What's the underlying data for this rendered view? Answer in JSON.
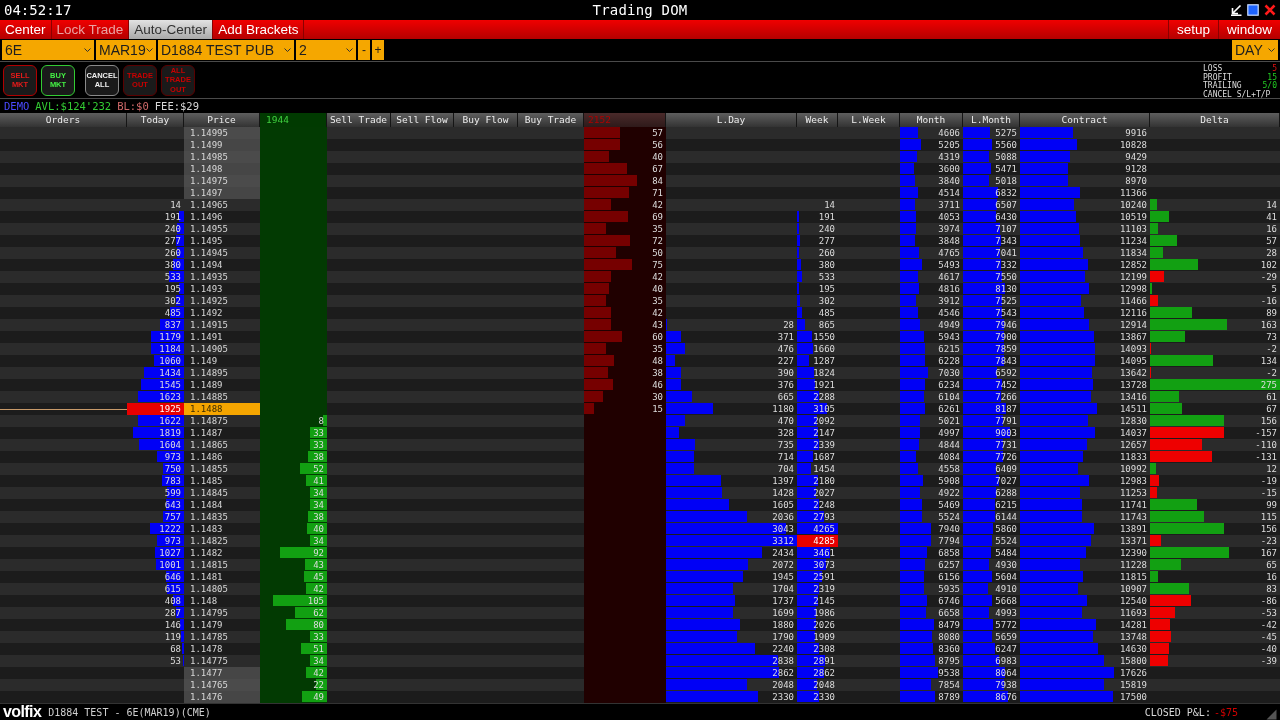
{
  "title_bar": {
    "time": "04:52:17",
    "title": "Trading DOM"
  },
  "toolbar": {
    "items": [
      {
        "label": "Center",
        "on": false,
        "disabled": false
      },
      {
        "label": "Lock Trade",
        "on": false,
        "disabled": true
      },
      {
        "label": "Auto-Center",
        "on": true,
        "disabled": false
      },
      {
        "label": "Add Brackets",
        "on": false,
        "disabled": false
      }
    ],
    "right_items": [
      "setup",
      "window"
    ]
  },
  "selectors": [
    {
      "value": "6E",
      "kind": "dropdown"
    },
    {
      "value": "MAR19",
      "kind": "dropdown"
    },
    {
      "value": "D1884 TEST PUB",
      "kind": "dropdown"
    },
    {
      "value": "2",
      "kind": "dropdown"
    },
    {
      "value": "-",
      "kind": "stepper"
    },
    {
      "value": "+",
      "kind": "stepper"
    }
  ],
  "session": {
    "value": "DAY"
  },
  "order_buttons": [
    {
      "label": "SELL MKT",
      "kind": "sell"
    },
    {
      "label": "BUY MKT",
      "kind": "buy"
    },
    {
      "label": "CANCEL ALL",
      "kind": "cancel"
    },
    {
      "label": "TRADE OUT",
      "kind": "exit"
    },
    {
      "label": "ALL TRADE OUT",
      "kind": "exit"
    }
  ],
  "risk_settings": [
    {
      "label": "LOSS",
      "value": "5",
      "kind": "loss"
    },
    {
      "label": "PROFIT",
      "value": "15",
      "kind": "gain"
    },
    {
      "label": "TRAILING",
      "value": "5/0",
      "kind": "gain"
    },
    {
      "label": "CANCEL S/L+T/P",
      "kind": "action"
    }
  ],
  "account": [
    {
      "text": "DEMO",
      "kind": "mode"
    },
    {
      "text": "AVL:$124'232",
      "kind": "available"
    },
    {
      "text": "BL:$0",
      "kind": "balance"
    },
    {
      "text": "FEE:$29",
      "kind": "fee"
    }
  ],
  "dom": {
    "columns": [
      {
        "label": "Orders",
        "kind": "orders"
      },
      {
        "label": "Today",
        "kind": "today"
      },
      {
        "label": "Price",
        "kind": "price"
      },
      {
        "label": "1944",
        "kind": "green_volume"
      },
      {
        "label": "Sell Trade",
        "kind": "empty"
      },
      {
        "label": "Sell Flow",
        "kind": "empty"
      },
      {
        "label": "Buy Flow",
        "kind": "empty"
      },
      {
        "label": "Buy Trade",
        "kind": "empty"
      },
      {
        "label": "2152",
        "kind": "red_volume"
      },
      {
        "label": "L.Day",
        "kind": "volume"
      },
      {
        "label": "Week",
        "kind": "week"
      },
      {
        "label": "L.Week",
        "kind": "empty"
      },
      {
        "label": "Month",
        "kind": "volume"
      },
      {
        "label": "L.Month",
        "kind": "volume"
      },
      {
        "label": "Contract",
        "kind": "volume"
      },
      {
        "label": "Delta",
        "kind": "delta"
      }
    ],
    "rows": [
      {
        "price": "1.14995",
        "red_volume": "57",
        "month": "4606",
        "l_month": "5275",
        "contract": "9916",
        "current": false,
        "outside_range": true,
        "week_high": false
      },
      {
        "price": "1.1499",
        "red_volume": "56",
        "month": "5205",
        "l_month": "5560",
        "contract": "10828",
        "current": false,
        "outside_range": true,
        "week_high": false
      },
      {
        "price": "1.14985",
        "red_volume": "40",
        "month": "4319",
        "l_month": "5088",
        "contract": "9429",
        "current": false,
        "outside_range": true,
        "week_high": false
      },
      {
        "price": "1.1498",
        "red_volume": "67",
        "month": "3600",
        "l_month": "5471",
        "contract": "9128",
        "current": false,
        "outside_range": true,
        "week_high": false
      },
      {
        "price": "1.14975",
        "red_volume": "84",
        "month": "3840",
        "l_month": "5018",
        "contract": "8970",
        "current": false,
        "outside_range": true,
        "week_high": false
      },
      {
        "price": "1.1497",
        "red_volume": "71",
        "month": "4514",
        "l_month": "6832",
        "contract": "11366",
        "current": false,
        "outside_range": true,
        "week_high": false
      },
      {
        "price": "1.14965",
        "today": "14",
        "red_volume": "42",
        "week": "14",
        "month": "3711",
        "l_month": "6507",
        "contract": "10240",
        "delta": "14",
        "current": false,
        "outside_range": false,
        "week_high": false
      },
      {
        "price": "1.1496",
        "today": "191",
        "red_volume": "69",
        "week": "191",
        "month": "4053",
        "l_month": "6430",
        "contract": "10519",
        "delta": "41",
        "current": false,
        "outside_range": false,
        "week_high": false
      },
      {
        "price": "1.14955",
        "today": "240",
        "red_volume": "35",
        "week": "240",
        "month": "3974",
        "l_month": "7107",
        "contract": "11103",
        "delta": "16",
        "current": false,
        "outside_range": false,
        "week_high": false
      },
      {
        "price": "1.1495",
        "today": "277",
        "red_volume": "72",
        "week": "277",
        "month": "3848",
        "l_month": "7343",
        "contract": "11234",
        "delta": "57",
        "current": false,
        "outside_range": false,
        "week_high": false
      },
      {
        "price": "1.14945",
        "today": "260",
        "red_volume": "50",
        "week": "260",
        "month": "4765",
        "l_month": "7041",
        "contract": "11834",
        "delta": "28",
        "current": false,
        "outside_range": false,
        "week_high": false
      },
      {
        "price": "1.1494",
        "today": "380",
        "red_volume": "75",
        "week": "380",
        "month": "5493",
        "l_month": "7332",
        "contract": "12852",
        "delta": "102",
        "current": false,
        "outside_range": false,
        "week_high": false
      },
      {
        "price": "1.14935",
        "today": "533",
        "red_volume": "42",
        "week": "533",
        "month": "4617",
        "l_month": "7550",
        "contract": "12199",
        "delta": "-29",
        "current": false,
        "outside_range": false,
        "week_high": false
      },
      {
        "price": "1.1493",
        "today": "195",
        "red_volume": "40",
        "week": "195",
        "month": "4816",
        "l_month": "8130",
        "contract": "12998",
        "delta": "5",
        "current": false,
        "outside_range": false,
        "week_high": false
      },
      {
        "price": "1.14925",
        "today": "302",
        "red_volume": "35",
        "week": "302",
        "month": "3912",
        "l_month": "7525",
        "contract": "11466",
        "delta": "-16",
        "current": false,
        "outside_range": false,
        "week_high": false
      },
      {
        "price": "1.1492",
        "today": "485",
        "red_volume": "42",
        "week": "485",
        "month": "4546",
        "l_month": "7543",
        "contract": "12116",
        "delta": "89",
        "current": false,
        "outside_range": false,
        "week_high": false
      },
      {
        "price": "1.14915",
        "today": "837",
        "red_volume": "43",
        "l_day": "28",
        "week": "865",
        "month": "4949",
        "l_month": "7946",
        "contract": "12914",
        "delta": "163",
        "current": false,
        "outside_range": false,
        "week_high": false
      },
      {
        "price": "1.1491",
        "today": "1179",
        "red_volume": "60",
        "l_day": "371",
        "week": "1550",
        "month": "5943",
        "l_month": "7900",
        "contract": "13867",
        "delta": "73",
        "current": false,
        "outside_range": false,
        "week_high": false
      },
      {
        "price": "1.14905",
        "today": "1184",
        "red_volume": "35",
        "l_day": "476",
        "week": "1660",
        "month": "6215",
        "l_month": "7859",
        "contract": "14093",
        "delta": "-2",
        "current": false,
        "outside_range": false,
        "week_high": false
      },
      {
        "price": "1.149",
        "today": "1060",
        "red_volume": "48",
        "l_day": "227",
        "week": "1287",
        "month": "6228",
        "l_month": "7843",
        "contract": "14095",
        "delta": "134",
        "current": false,
        "outside_range": false,
        "week_high": false
      },
      {
        "price": "1.14895",
        "today": "1434",
        "red_volume": "38",
        "l_day": "390",
        "week": "1824",
        "month": "7030",
        "l_month": "6592",
        "contract": "13642",
        "delta": "-2",
        "current": false,
        "outside_range": false,
        "week_high": false
      },
      {
        "price": "1.1489",
        "today": "1545",
        "red_volume": "46",
        "l_day": "376",
        "week": "1921",
        "month": "6234",
        "l_month": "7452",
        "contract": "13728",
        "delta": "275",
        "current": false,
        "outside_range": false,
        "week_high": false
      },
      {
        "price": "1.14885",
        "today": "1623",
        "red_volume": "30",
        "l_day": "665",
        "week": "2288",
        "month": "6104",
        "l_month": "7266",
        "contract": "13416",
        "delta": "61",
        "current": false,
        "outside_range": false,
        "week_high": false
      },
      {
        "price": "1.1488",
        "today": "1925",
        "red_volume": "15",
        "l_day": "1180",
        "week": "3105",
        "month": "6261",
        "l_month": "8187",
        "contract": "14511",
        "delta": "67",
        "current": true,
        "outside_range": false,
        "week_high": false
      },
      {
        "price": "1.14875",
        "today": "1622",
        "green_volume": "8",
        "l_day": "470",
        "week": "2092",
        "month": "5021",
        "l_month": "7791",
        "contract": "12830",
        "delta": "156",
        "current": false,
        "outside_range": false,
        "week_high": false
      },
      {
        "price": "1.1487",
        "today": "1819",
        "green_volume": "33",
        "l_day": "328",
        "week": "2147",
        "month": "4997",
        "l_month": "9003",
        "contract": "14037",
        "delta": "-157",
        "current": false,
        "outside_range": false,
        "week_high": false
      },
      {
        "price": "1.14865",
        "today": "1604",
        "green_volume": "33",
        "l_day": "735",
        "week": "2339",
        "month": "4844",
        "l_month": "7731",
        "contract": "12657",
        "delta": "-110",
        "current": false,
        "outside_range": false,
        "week_high": false
      },
      {
        "price": "1.1486",
        "today": "973",
        "green_volume": "38",
        "l_day": "714",
        "week": "1687",
        "month": "4084",
        "l_month": "7726",
        "contract": "11833",
        "delta": "-131",
        "current": false,
        "outside_range": false,
        "week_high": false
      },
      {
        "price": "1.14855",
        "today": "750",
        "green_volume": "52",
        "l_day": "704",
        "week": "1454",
        "month": "4558",
        "l_month": "6409",
        "contract": "10992",
        "delta": "12",
        "current": false,
        "outside_range": false,
        "week_high": false
      },
      {
        "price": "1.1485",
        "today": "783",
        "green_volume": "41",
        "l_day": "1397",
        "week": "2180",
        "month": "5908",
        "l_month": "7027",
        "contract": "12983",
        "delta": "-19",
        "current": false,
        "outside_range": false,
        "week_high": false
      },
      {
        "price": "1.14845",
        "today": "599",
        "green_volume": "34",
        "l_day": "1428",
        "week": "2027",
        "month": "4922",
        "l_month": "6288",
        "contract": "11253",
        "delta": "-15",
        "current": false,
        "outside_range": false,
        "week_high": false
      },
      {
        "price": "1.1484",
        "today": "643",
        "green_volume": "34",
        "l_day": "1605",
        "week": "2248",
        "month": "5469",
        "l_month": "6215",
        "contract": "11741",
        "delta": "99",
        "current": false,
        "outside_range": false,
        "week_high": false
      },
      {
        "price": "1.14835",
        "today": "757",
        "green_volume": "38",
        "l_day": "2036",
        "week": "2793",
        "month": "5524",
        "l_month": "6144",
        "contract": "11743",
        "delta": "115",
        "current": false,
        "outside_range": false,
        "week_high": false
      },
      {
        "price": "1.1483",
        "today": "1222",
        "green_volume": "40",
        "l_day": "3043",
        "week": "4265",
        "month": "7940",
        "l_month": "5860",
        "contract": "13891",
        "delta": "156",
        "current": false,
        "outside_range": false,
        "week_high": false
      },
      {
        "price": "1.14825",
        "today": "973",
        "green_volume": "34",
        "l_day": "3312",
        "week": "4285",
        "month": "7794",
        "l_month": "5524",
        "contract": "13371",
        "delta": "-23",
        "current": false,
        "outside_range": false,
        "week_high": true
      },
      {
        "price": "1.1482",
        "today": "1027",
        "green_volume": "92",
        "l_day": "2434",
        "week": "3461",
        "month": "6858",
        "l_month": "5484",
        "contract": "12390",
        "delta": "167",
        "current": false,
        "outside_range": false,
        "week_high": false
      },
      {
        "price": "1.14815",
        "today": "1001",
        "green_volume": "43",
        "l_day": "2072",
        "week": "3073",
        "month": "6257",
        "l_month": "4930",
        "contract": "11228",
        "delta": "65",
        "current": false,
        "outside_range": false,
        "week_high": false
      },
      {
        "price": "1.1481",
        "today": "646",
        "green_volume": "45",
        "l_day": "1945",
        "week": "2591",
        "month": "6156",
        "l_month": "5604",
        "contract": "11815",
        "delta": "16",
        "current": false,
        "outside_range": false,
        "week_high": false
      },
      {
        "price": "1.14805",
        "today": "615",
        "green_volume": "42",
        "l_day": "1704",
        "week": "2319",
        "month": "5935",
        "l_month": "4910",
        "contract": "10907",
        "delta": "83",
        "current": false,
        "outside_range": false,
        "week_high": false
      },
      {
        "price": "1.148",
        "today": "408",
        "green_volume": "105",
        "l_day": "1737",
        "week": "2145",
        "month": "6746",
        "l_month": "5668",
        "contract": "12540",
        "delta": "-86",
        "current": false,
        "outside_range": false,
        "week_high": false
      },
      {
        "price": "1.14795",
        "today": "287",
        "green_volume": "62",
        "l_day": "1699",
        "week": "1986",
        "month": "6658",
        "l_month": "4993",
        "contract": "11693",
        "delta": "-53",
        "current": false,
        "outside_range": false,
        "week_high": false
      },
      {
        "price": "1.1479",
        "today": "146",
        "green_volume": "80",
        "l_day": "1880",
        "week": "2026",
        "month": "8479",
        "l_month": "5772",
        "contract": "14281",
        "delta": "-42",
        "current": false,
        "outside_range": false,
        "week_high": false
      },
      {
        "price": "1.14785",
        "today": "119",
        "green_volume": "33",
        "l_day": "1790",
        "week": "1909",
        "month": "8080",
        "l_month": "5659",
        "contract": "13748",
        "delta": "-45",
        "current": false,
        "outside_range": false,
        "week_high": false
      },
      {
        "price": "1.1478",
        "today": "68",
        "green_volume": "51",
        "l_day": "2240",
        "week": "2308",
        "month": "8360",
        "l_month": "6247",
        "contract": "14630",
        "delta": "-40",
        "current": false,
        "outside_range": false,
        "week_high": false
      },
      {
        "price": "1.14775",
        "today": "53",
        "green_volume": "34",
        "l_day": "2838",
        "week": "2891",
        "month": "8795",
        "l_month": "6983",
        "contract": "15800",
        "delta": "-39",
        "current": false,
        "outside_range": false,
        "week_high": false
      },
      {
        "price": "1.1477",
        "green_volume": "42",
        "l_day": "2862",
        "week": "2862",
        "month": "9538",
        "l_month": "8064",
        "contract": "17626",
        "current": false,
        "outside_range": true,
        "week_high": false
      },
      {
        "price": "1.14765",
        "green_volume": "22",
        "l_day": "2048",
        "week": "2048",
        "month": "7854",
        "l_month": "7938",
        "contract": "15819",
        "current": false,
        "outside_range": true,
        "week_high": false
      },
      {
        "price": "1.1476",
        "green_volume": "49",
        "l_day": "2330",
        "week": "2330",
        "month": "8789",
        "l_month": "8676",
        "contract": "17500",
        "current": false,
        "outside_range": true,
        "week_high": false
      }
    ]
  },
  "status_bar": {
    "logo": "volfix",
    "account": "D1884 TEST - 6E(MAR19)(CME)",
    "pnl_label": "CLOSED P&L:",
    "pnl_value": "-$75"
  }
}
